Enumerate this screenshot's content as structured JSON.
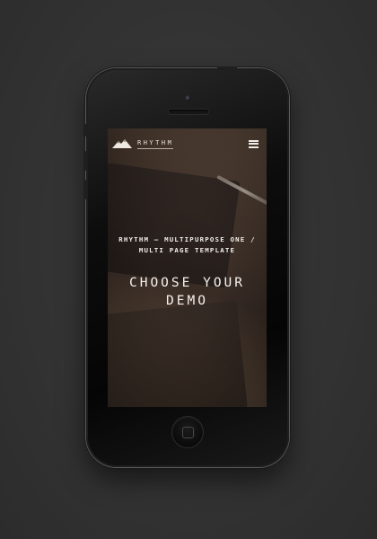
{
  "page": {
    "background_color": "#353535"
  },
  "device": {
    "type": "iphone-mockup",
    "color": "#0d0d0d"
  },
  "app": {
    "logo_icon": "mountain-logo-icon",
    "brand_name": "RHYTHM",
    "menu_icon": "hamburger-menu-icon",
    "hero": {
      "subtitle": "RHYTHM — MULTIPURPOSE ONE /\nMULTI PAGE TEMPLATE",
      "headline": "CHOOSE YOUR\nDEMO"
    },
    "text_color": "#f2eee9"
  },
  "home_button": {
    "icon": "home-button-icon"
  }
}
